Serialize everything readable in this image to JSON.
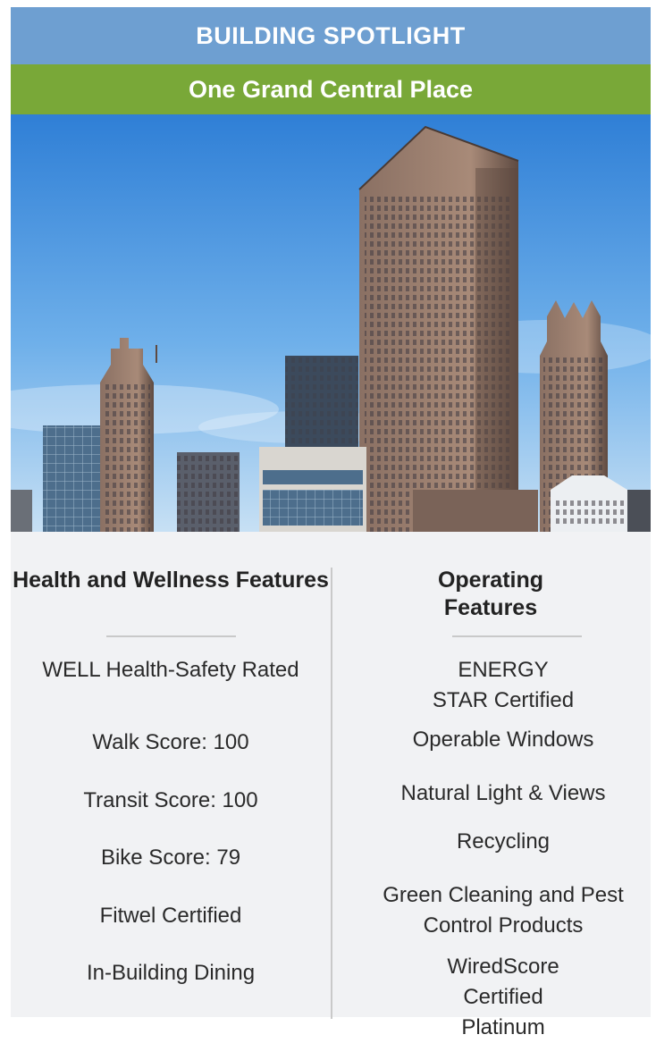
{
  "header": {
    "spotlight": "BUILDING SPOTLIGHT",
    "building_name": "One Grand Central Place"
  },
  "left": {
    "title": "Health and Wellness Features",
    "items": [
      "WELL Health-Safety Rated",
      "Walk Score: 100",
      "Transit Score: 100",
      "Bike Score: 79",
      "Fitwel Certified",
      "In-Building Dining"
    ]
  },
  "right": {
    "title": "Operating Features",
    "items": [
      "ENERGY STAR Certified",
      "Operable Windows",
      "Natural Light & Views",
      "Recycling",
      "Green Cleaning and Pest Control Products",
      "WiredScore Certified Platinum"
    ]
  },
  "colors": {
    "header_blue": "#6e9fd1",
    "header_green": "#79a838",
    "panel_bg": "#f1f2f4"
  }
}
